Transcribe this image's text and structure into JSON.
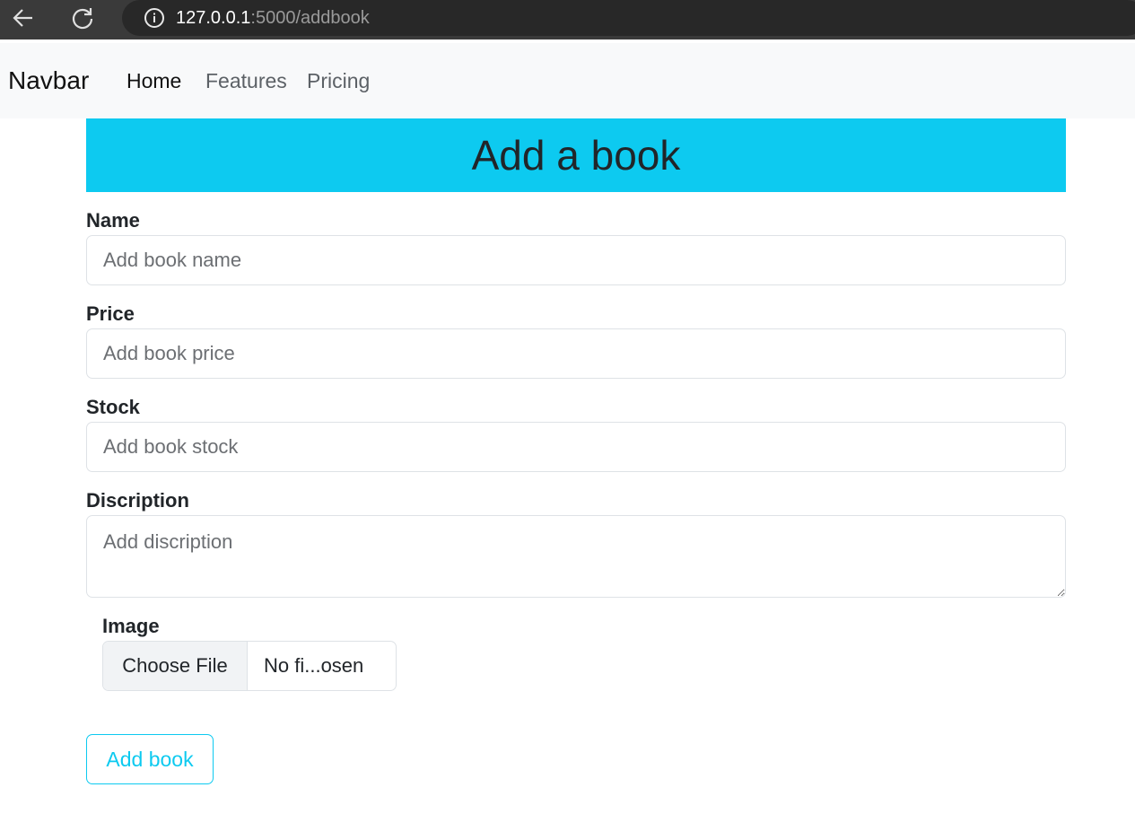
{
  "browser": {
    "url_host": "127.0.0.1",
    "url_path": ":5000/addbook"
  },
  "navbar": {
    "brand": "Navbar",
    "links": [
      "Home",
      "Features",
      "Pricing"
    ]
  },
  "page": {
    "title": "Add a book"
  },
  "form": {
    "name_label": "Name",
    "name_placeholder": "Add book name",
    "price_label": "Price",
    "price_placeholder": "Add book price",
    "stock_label": "Stock",
    "stock_placeholder": "Add book stock",
    "description_label": "Discription",
    "description_placeholder": "Add discription",
    "image_label": "Image",
    "file_button": "Choose File",
    "file_status": "No fi...osen",
    "submit_label": "Add book"
  },
  "colors": {
    "accent": "#0dcaf0",
    "navbar_bg": "#f8f9fa"
  }
}
